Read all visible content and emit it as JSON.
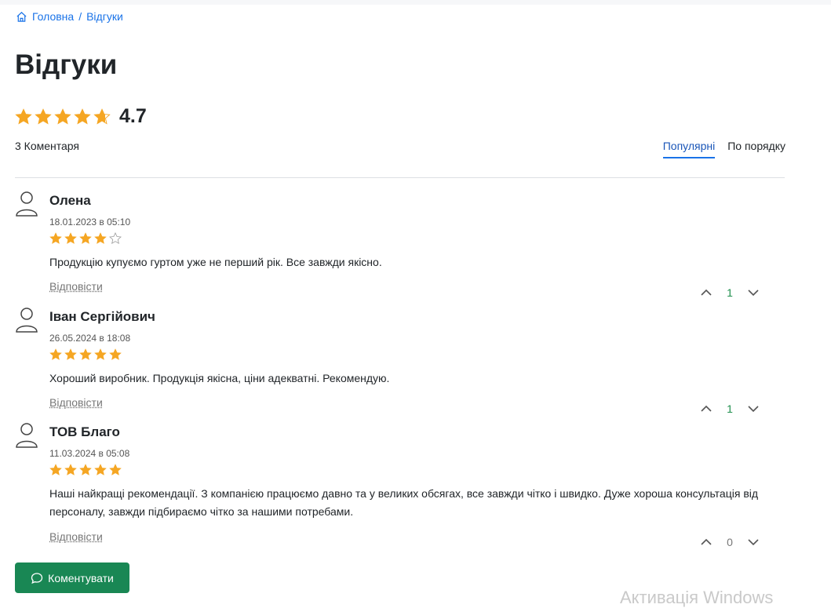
{
  "breadcrumb": {
    "home": "Головна",
    "separator": "/",
    "current": "Відгуки"
  },
  "page": {
    "title": "Відгуки"
  },
  "summary": {
    "rating": "4.7",
    "comments_count": "3 Коментаря"
  },
  "sort": {
    "popular": "Популярні",
    "ordered": "По порядку"
  },
  "colors": {
    "star": "#f5a623",
    "accent": "#1a73e8",
    "button": "#198754",
    "vote_positive": "#1e8f4d"
  },
  "reviews": [
    {
      "author": "Олена",
      "date": "18.01.2023 в 05:10",
      "stars": 4,
      "text": "Продукцію купуємо гуртом уже не перший рік. Все завжди якісно.",
      "reply": "Відповісти",
      "votes": "1"
    },
    {
      "author": "Іван Сергійович",
      "date": "26.05.2024 в 18:08",
      "stars": 5,
      "text": "Хороший виробник. Продукція якісна, ціни адекватні. Рекомендую.",
      "reply": "Відповісти",
      "votes": "1"
    },
    {
      "author": "ТОВ Благо",
      "date": "11.03.2024 в 05:08",
      "stars": 5,
      "text": "Наші найкращі рекомендації. З компанією працюємо давно та у великих обсягах, все завжди чітко і швидко. Дуже хороша консультація від персоналу, завжди підбираємо чітко за нашими потребами.",
      "reply": "Відповісти",
      "votes": "0"
    }
  ],
  "actions": {
    "comment": "Коментувати"
  },
  "watermark": "Активація Windows"
}
